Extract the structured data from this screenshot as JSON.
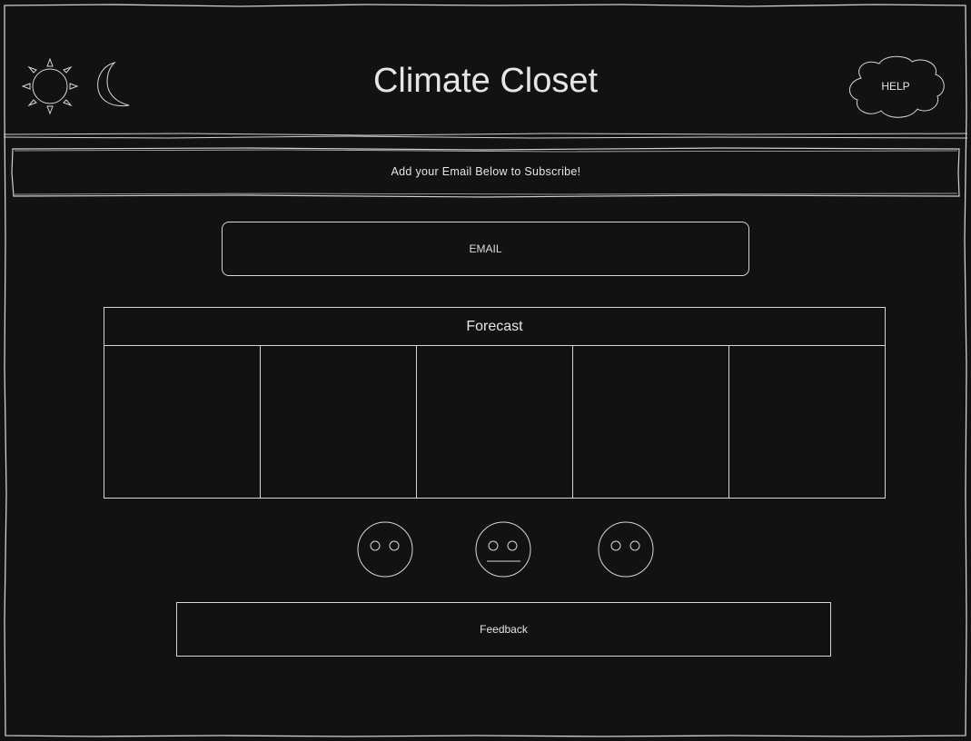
{
  "header": {
    "title": "Climate Closet",
    "help_label": "HELP"
  },
  "subscribe": {
    "banner_text": "Add your Email Below to Subscribe!",
    "email_placeholder": "EMAIL"
  },
  "forecast": {
    "title": "Forecast",
    "days": [
      "",
      "",
      "",
      "",
      ""
    ]
  },
  "feedback": {
    "faces": [
      "blank-face-icon",
      "neutral-face-icon",
      "blank-face-icon"
    ],
    "button_label": "Feedback"
  },
  "colors": {
    "background": "#121212",
    "stroke": "#d6d6d6",
    "text": "#e6e6e6"
  }
}
